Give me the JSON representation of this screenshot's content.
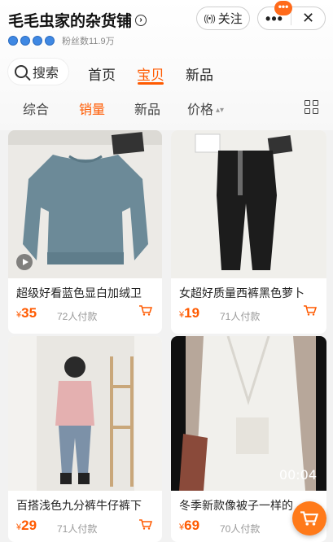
{
  "shop": {
    "name": "毛毛虫家的杂货铺",
    "fans": "粉丝数11.9万",
    "follow_label": "关注"
  },
  "capsule": {
    "more": "•••",
    "close": "✕",
    "badge": "•••"
  },
  "search": {
    "label": "搜索"
  },
  "tabs": [
    {
      "label": "首页"
    },
    {
      "label": "宝贝"
    },
    {
      "label": "新品"
    }
  ],
  "sort": [
    {
      "label": "综合"
    },
    {
      "label": "销量"
    },
    {
      "label": "新品"
    },
    {
      "label": "价格"
    }
  ],
  "products": [
    {
      "name": "超级好看蓝色显白加绒卫",
      "price_symbol": "¥",
      "price": "35",
      "paid": "72人付款"
    },
    {
      "name": "女超好质量西裤黑色萝卜",
      "price_symbol": "¥",
      "price": "19",
      "paid": "71人付款"
    },
    {
      "name": "百搭浅色九分裤牛仔裤下",
      "price_symbol": "¥",
      "price": "29",
      "paid": "71人付款"
    },
    {
      "name": "冬季新款像被子一样的",
      "price_symbol": "¥",
      "price": "69",
      "paid": "70人付款",
      "video_duration": "00:04"
    }
  ],
  "colors": {
    "accent": "#ff5a00"
  }
}
